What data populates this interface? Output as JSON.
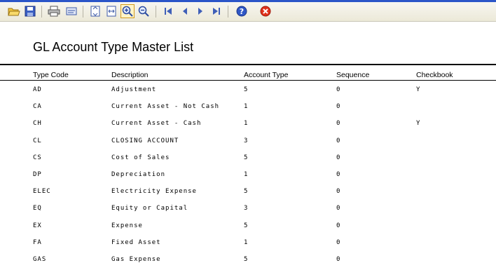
{
  "toolbar": {
    "buttons": [
      {
        "name": "open-icon"
      },
      {
        "name": "save-icon"
      },
      {
        "name": "print-icon"
      },
      {
        "name": "export-icon"
      },
      {
        "name": "fit-page-icon"
      },
      {
        "name": "fit-width-icon"
      },
      {
        "name": "zoom-in-icon"
      },
      {
        "name": "zoom-out-icon"
      },
      {
        "name": "first-page-icon"
      },
      {
        "name": "prev-page-icon"
      },
      {
        "name": "next-page-icon"
      },
      {
        "name": "last-page-icon"
      },
      {
        "name": "help-icon"
      },
      {
        "name": "close-icon"
      }
    ]
  },
  "report": {
    "title": "GL Account Type Master List",
    "columns": [
      "Type Code",
      "Description",
      "Account Type",
      "Sequence",
      "Checkbook"
    ],
    "rows": [
      {
        "code": "AD",
        "description": "Adjustment",
        "account_type": "5",
        "sequence": "0",
        "checkbook": "Y"
      },
      {
        "code": "CA",
        "description": "Current Asset - Not Cash",
        "account_type": "1",
        "sequence": "0",
        "checkbook": ""
      },
      {
        "code": "CH",
        "description": "Current Asset - Cash",
        "account_type": "1",
        "sequence": "0",
        "checkbook": "Y"
      },
      {
        "code": "CL",
        "description": "CLOSING ACCOUNT",
        "account_type": "3",
        "sequence": "0",
        "checkbook": ""
      },
      {
        "code": "CS",
        "description": "Cost of Sales",
        "account_type": "5",
        "sequence": "0",
        "checkbook": ""
      },
      {
        "code": "DP",
        "description": "Depreciation",
        "account_type": "1",
        "sequence": "0",
        "checkbook": ""
      },
      {
        "code": "ELEC",
        "description": "Electricity Expense",
        "account_type": "5",
        "sequence": "0",
        "checkbook": ""
      },
      {
        "code": "EQ",
        "description": "Equity or Capital",
        "account_type": "3",
        "sequence": "0",
        "checkbook": ""
      },
      {
        "code": "EX",
        "description": "Expense",
        "account_type": "5",
        "sequence": "0",
        "checkbook": ""
      },
      {
        "code": "FA",
        "description": "Fixed Asset",
        "account_type": "1",
        "sequence": "0",
        "checkbook": ""
      },
      {
        "code": "GAS",
        "description": "Gas Expense",
        "account_type": "5",
        "sequence": "0",
        "checkbook": ""
      }
    ]
  }
}
